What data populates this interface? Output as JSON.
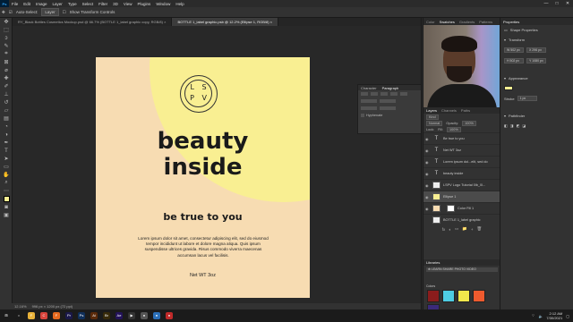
{
  "menubar": {
    "app_icon": "Ps",
    "items": [
      "File",
      "Edit",
      "Image",
      "Layer",
      "Type",
      "Select",
      "Filter",
      "3D",
      "View",
      "Plugins",
      "Window",
      "Help"
    ],
    "window_controls": [
      "—",
      "□",
      "✕"
    ]
  },
  "options": {
    "auto_select": "Auto-Select:",
    "auto_select_value": "Layer",
    "show_transform": "Show Transform Controls"
  },
  "tabs": [
    {
      "label": "RY_Black Bottles Cosmetics Mockup.psd @ 66.7% (BOTTLE 1_label graphic copy, RGB/8) ×"
    },
    {
      "label": "BOTTLE 1_label graphic.psb @ 12.2% (Ellipse 1, RGB/8) ×"
    }
  ],
  "design": {
    "logo_line1": "L S",
    "logo_line2": "P V",
    "headline": "beauty inside",
    "tagline": "be true to you",
    "body": "Lorem ipsum dolor sit amet, consectetur adipiscing elit, sed do eiusmod tempor incididunt ut labore et dolore magna aliqua. Quis ipsum suspendisse ultrices gravida. Risus commodo viverra maecenas accumsan lacus vel facilisis.",
    "net_wt": "Net WT 3oz"
  },
  "paragraph_panel": {
    "tabs": [
      "Character",
      "Paragraph"
    ],
    "hyphenate": "Hyphenate"
  },
  "panel_tabs": [
    "Color",
    "Swatches",
    "Gradients",
    "Patterns"
  ],
  "layers_panel": {
    "tabs": [
      "Layers",
      "Channels",
      "Paths"
    ],
    "kind": "Kind",
    "blend": "Normal",
    "opacity_label": "Opacity:",
    "opacity_value": "100%",
    "fill_label": "Fill:",
    "fill_value": "100%",
    "lock_label": "Lock:",
    "layers": [
      {
        "name": "Be true to you",
        "type": "text"
      },
      {
        "name": "Net WT 3oz",
        "type": "text"
      },
      {
        "name": "Lorem ipsum dol...elit, sed do",
        "type": "text"
      },
      {
        "name": "beauty inside",
        "type": "text"
      },
      {
        "name": "LSPV Logo Tutorial 0lb_0l...",
        "type": "image"
      },
      {
        "name": "Ellipse 1",
        "type": "shape",
        "selected": true
      },
      {
        "name": "Color Fill 1",
        "type": "fill"
      },
      {
        "name": "BOTTLE 1_label graphic",
        "type": "image"
      }
    ],
    "footer_icons": [
      "fx",
      "◐",
      "▭",
      "📁",
      "+",
      "🗑"
    ]
  },
  "libraries": {
    "title": "Libraries",
    "selected": "⊕ LEARN SHARE PHOTO VIDEO",
    "colors_label": "Colors",
    "swatches": [
      "#8b1c1c",
      "#4ecde3",
      "#f1e74b",
      "#ef5a2e",
      "#3b2a7a"
    ]
  },
  "properties": {
    "title": "Properties",
    "shape_label": "Shape Properties",
    "transform_label": "Transform",
    "w_value": "W 502 px",
    "h_value": "H 502 px",
    "x_value": "X 296 px",
    "y_value": "Y 1080 px",
    "appearance_label": "Appearance",
    "pathfinder_label": "Pathfinder",
    "stroke_label": "Stroke",
    "stroke_value": "1 px"
  },
  "status": {
    "zoom": "12.16%",
    "doc": "996 px × 1200 px (72 ppi)"
  },
  "taskbar": {
    "time": "2:12 AM",
    "date": "7/30/2021",
    "icons": [
      {
        "name": "windows-icon",
        "glyph": "⊞",
        "color": "#1b1b1b"
      },
      {
        "name": "search-icon",
        "glyph": "○",
        "color": "#1b1b1b"
      },
      {
        "name": "file-explorer-icon",
        "glyph": "F",
        "color": "#e8b23a"
      },
      {
        "name": "chrome-icon",
        "glyph": "C",
        "color": "#d7443b"
      },
      {
        "name": "firefox-icon",
        "glyph": "F",
        "color": "#e66a1f"
      },
      {
        "name": "premiere-icon",
        "glyph": "Pr",
        "color": "#1a1849"
      },
      {
        "name": "photoshop-icon",
        "glyph": "Ps",
        "color": "#0f2f5a"
      },
      {
        "name": "illustrator-icon",
        "glyph": "Ai",
        "color": "#5a2a0a"
      },
      {
        "name": "bridge-icon",
        "glyph": "Br",
        "color": "#372a0a"
      },
      {
        "name": "aftereffects-icon",
        "glyph": "Ae",
        "color": "#23135a"
      },
      {
        "name": "media-icon",
        "glyph": "▶",
        "color": "#333"
      },
      {
        "name": "app-icon",
        "glyph": "●",
        "color": "#555"
      },
      {
        "name": "app2-icon",
        "glyph": "●",
        "color": "#2b6fb8"
      },
      {
        "name": "app3-icon",
        "glyph": "●",
        "color": "#c02a2a"
      }
    ]
  },
  "colors": {
    "canvas_bg": "#f7dcb2",
    "ellipse": "#f9ef92",
    "accent": "#31a8ff"
  }
}
